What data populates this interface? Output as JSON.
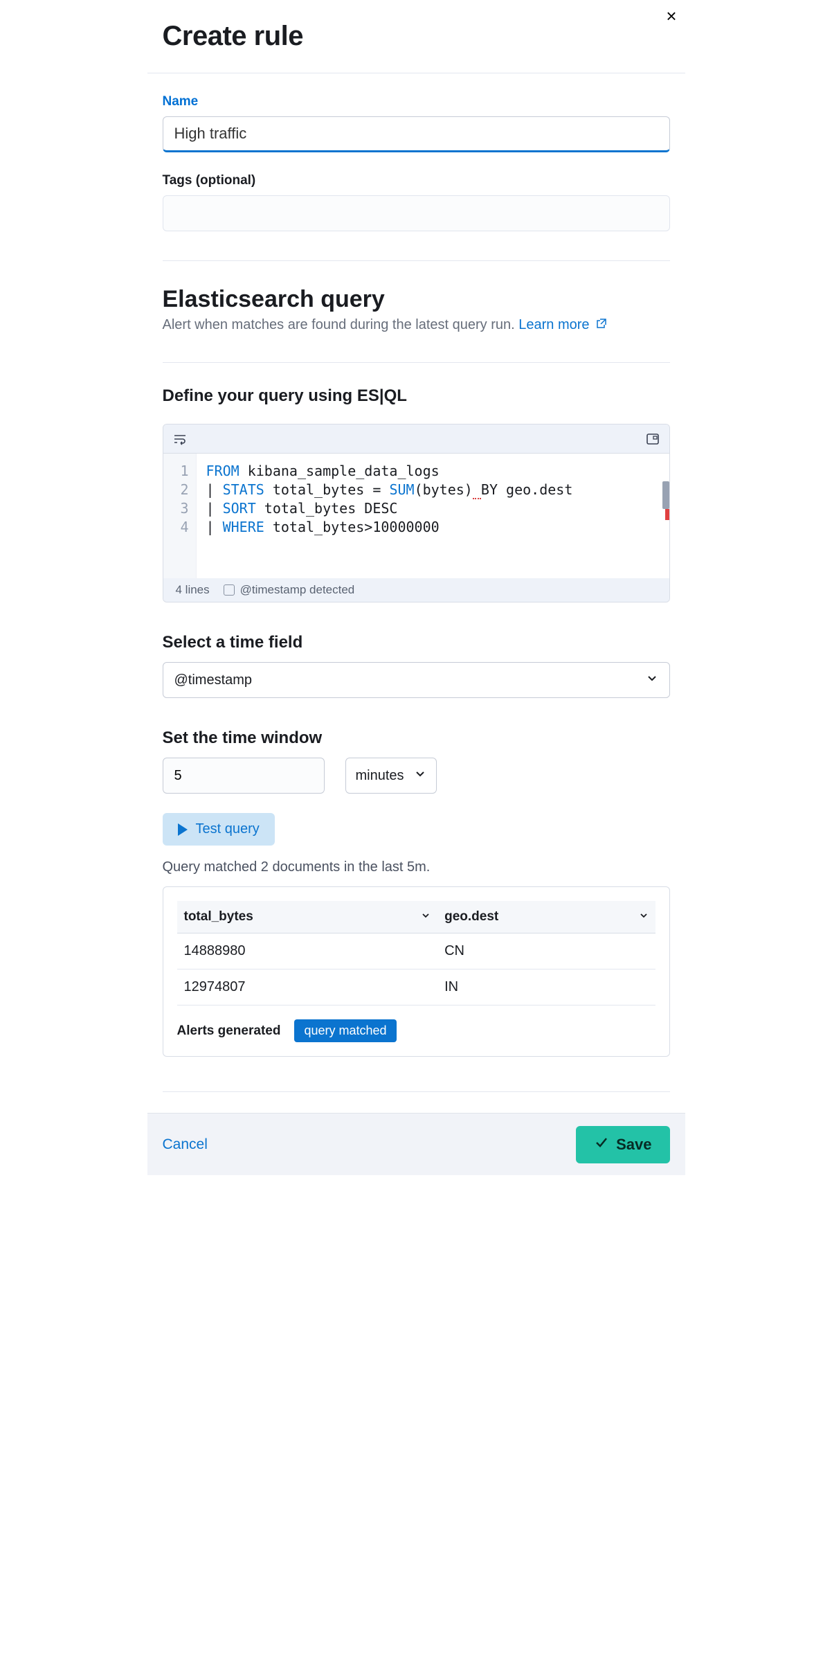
{
  "header": {
    "title": "Create rule"
  },
  "name_field": {
    "label": "Name",
    "value": "High traffic"
  },
  "tags_field": {
    "label": "Tags (optional)"
  },
  "query_section": {
    "title": "Elasticsearch query",
    "description": "Alert when matches are found during the latest query run.",
    "learn_more": "Learn more"
  },
  "define_query": {
    "title": "Define your query using ES|QL"
  },
  "editor": {
    "lines": [
      "1",
      "2",
      "3",
      "4"
    ],
    "code": {
      "l1_kw": "FROM",
      "l1_rest": " kibana_sample_data_logs",
      "l2_pipe": "| ",
      "l2_kw": "STATS",
      "l2_mid": " total_bytes = ",
      "l2_fn": "SUM",
      "l2_args": "(bytes)",
      "l2_sp": " ",
      "l2_by": "BY geo.dest",
      "l3_pipe": "| ",
      "l3_kw": "SORT",
      "l3_rest": " total_bytes DESC",
      "l4_pipe": "| ",
      "l4_kw": "WHERE",
      "l4_rest": " total_bytes>10000000"
    },
    "footer_lines": "4 lines",
    "footer_ts": "@timestamp detected"
  },
  "time_field": {
    "title": "Select a time field",
    "value": "@timestamp"
  },
  "time_window": {
    "title": "Set the time window",
    "value": "5",
    "unit": "minutes"
  },
  "test_query": {
    "label": "Test query"
  },
  "match_text": "Query matched 2 documents in the last 5m.",
  "results": {
    "columns": [
      "total_bytes",
      "geo.dest"
    ],
    "rows": [
      {
        "total_bytes": "14888980",
        "geo_dest": "CN"
      },
      {
        "total_bytes": "12974807",
        "geo_dest": "IN"
      }
    ],
    "alerts_label": "Alerts generated",
    "badge": "query matched"
  },
  "footer": {
    "cancel": "Cancel",
    "save": "Save"
  }
}
